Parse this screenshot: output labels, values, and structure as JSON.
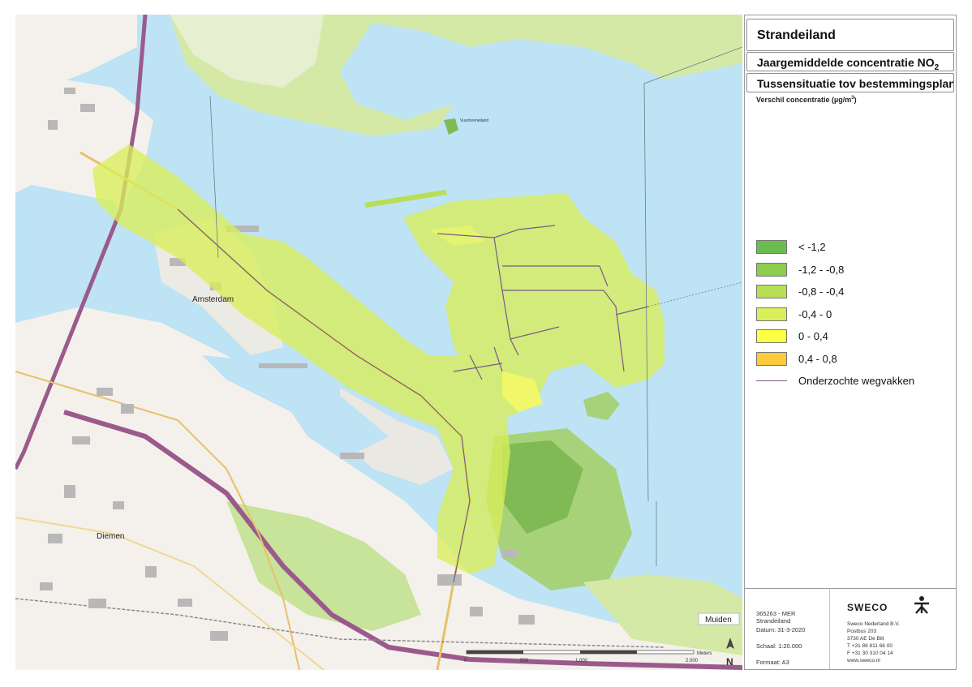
{
  "title": "Strandeiland",
  "subtitle_main": "Jaargemiddelde concentratie NO",
  "subtitle_sub": "2",
  "scenario": "Tussensituatie tov bestemmingsplan",
  "unit_label": "Verschil concentratie (µg/m",
  "unit_sup": "3",
  "unit_close": ")",
  "legend": [
    {
      "label": "< -1,2",
      "color": "#6cbd4f"
    },
    {
      "label": "-1,2 - -0,8",
      "color": "#8ccc4e"
    },
    {
      "label": "-0,8 - -0,4",
      "color": "#b7de55"
    },
    {
      "label": "-0,4 - 0",
      "color": "#d9ee5a"
    },
    {
      "label": "0 - 0,4",
      "color": "#ffff44"
    },
    {
      "label": "0,4 - 0,8",
      "color": "#ffc93c"
    }
  ],
  "legend_line": {
    "label": "Onderzochte wegvakken",
    "color": "#7a5a88"
  },
  "map_labels": {
    "amsterdam": "Amsterdam",
    "diemen": "Diemen",
    "muiden": "Muiden",
    "north": "N",
    "island": "Vuurtoreneiland"
  },
  "footer": {
    "project": "365263 - MER Strandeiland",
    "date": "Datum: 31-3-2020",
    "scale": "Schaal: 1:20.000",
    "format": "Formaat: A3"
  },
  "company": {
    "name": "SWECO",
    "address_lines": [
      "Sweco Nederland B.V.",
      "Postbus 203",
      "3730 AE De Bilt",
      "T +31 88 811 66 00",
      "F +31 30 310 04 14",
      "www.sweco.nl"
    ]
  },
  "scalebar": {
    "ticks": [
      "0",
      "500",
      "1.000",
      "2.000"
    ],
    "unit": "Meters"
  },
  "colors": {
    "water": "#bde3f5",
    "land": "#f4f1ec",
    "green": "#c8e39a",
    "road": "#e8c06a",
    "highway": "#9b5a8c"
  }
}
